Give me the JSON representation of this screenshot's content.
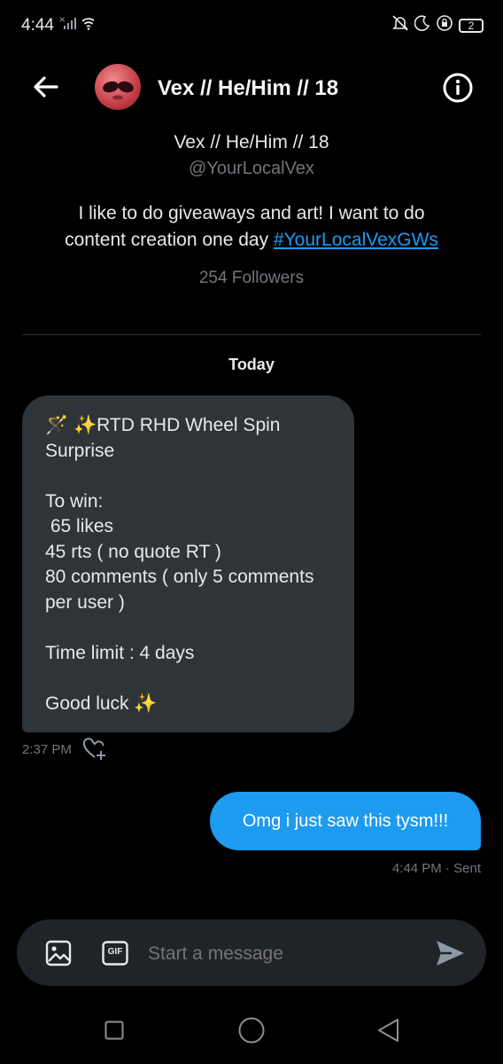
{
  "status_bar": {
    "time": "4:44",
    "battery": "2"
  },
  "header": {
    "name": "Vex // He/Him // 18"
  },
  "profile": {
    "name": "Vex // He/Him // 18",
    "handle": "@YourLocalVex",
    "bio_line1": "I like to do giveaways and art! I want to do",
    "bio_line2_text": "content creation one day ",
    "bio_hashtag": "#YourLocalVexGWs",
    "followers": "254 Followers"
  },
  "date_separator": "Today",
  "messages": {
    "received": {
      "lines": [
        "🪄 ✨RTD RHD Wheel Spin",
        "Surprise",
        "",
        "To win:",
        " 65 likes",
        "45 rts ( no quote RT )",
        "80 comments ( only 5 comments",
        "per user )",
        "",
        "Time limit : 4 days",
        "",
        "Good luck ✨"
      ],
      "time": "2:37 PM"
    },
    "sent": {
      "text": "Omg i just saw this tysm!!!",
      "meta": "4:44 PM · Sent"
    }
  },
  "composer": {
    "placeholder": "Start a message",
    "gif_label": "GIF"
  },
  "icons": {
    "back": "arrow-left-icon",
    "info": "info-icon",
    "image": "image-icon",
    "gif": "gif-icon",
    "send": "send-icon",
    "react": "heart-plus-icon"
  },
  "colors": {
    "accent": "#1d9bf0",
    "received_bubble": "#2f3438",
    "background": "#000000"
  }
}
